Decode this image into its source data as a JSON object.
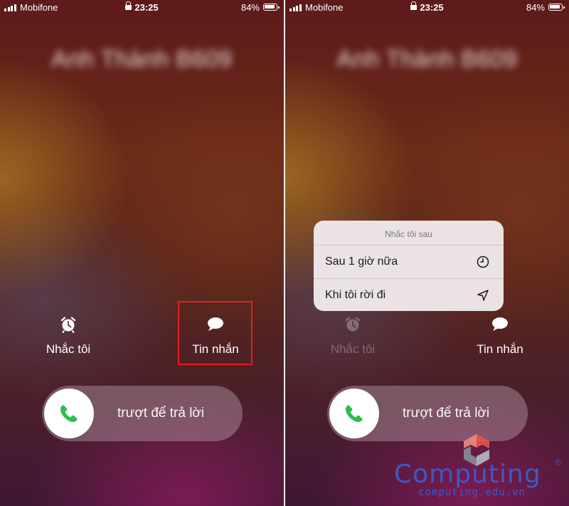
{
  "status_bar": {
    "carrier": "Mobifone",
    "time": "23:25",
    "battery": "84%"
  },
  "caller_name": "Anh Thành B609",
  "actions": {
    "remind_label": "Nhắc tôi",
    "message_label": "Tin nhắn"
  },
  "slider": {
    "label": "trượt để trả lời"
  },
  "remind_menu": {
    "title": "Nhắc tôi sau",
    "items": [
      {
        "label": "Sau 1 giờ nữa",
        "icon": "clock-icon"
      },
      {
        "label": "Khi tôi rời đi",
        "icon": "location-arrow-icon"
      }
    ]
  },
  "watermark": {
    "brand": "Computing",
    "url": "computing.edu.vn"
  },
  "colors": {
    "accept_green": "#2bbf4f",
    "highlight_red": "#e0201d",
    "watermark_blue": "#3d58c8"
  }
}
